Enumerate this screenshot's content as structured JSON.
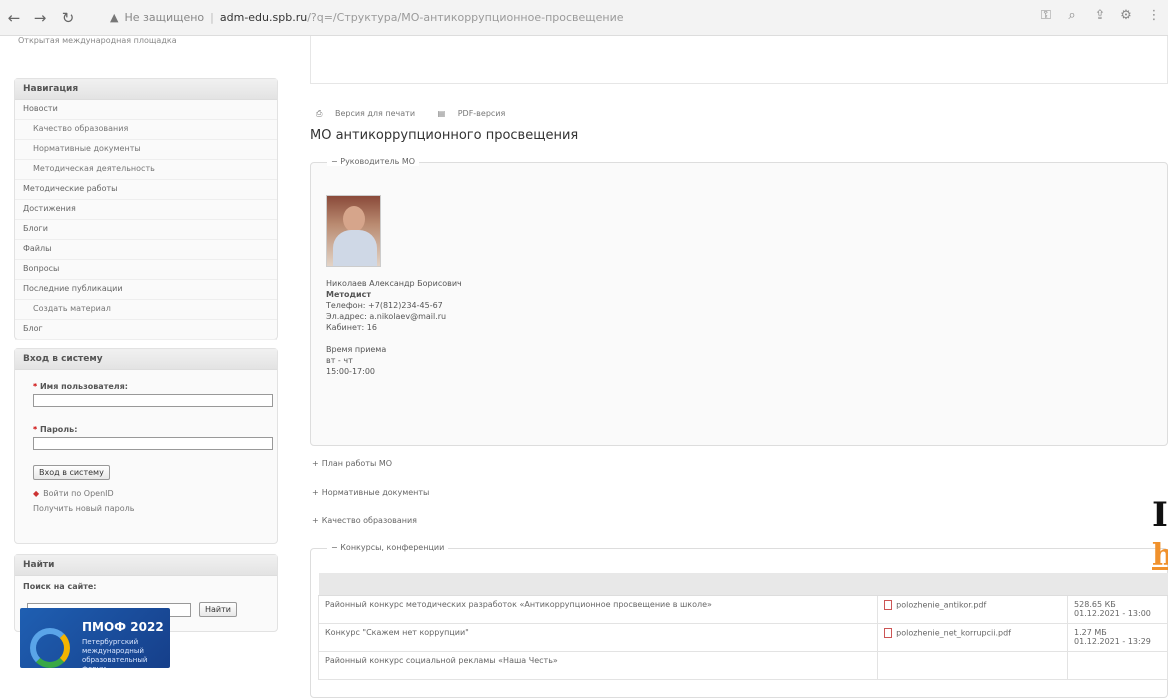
{
  "browser": {
    "insecure_label": "Не защищено",
    "host": "adm-edu.spb.ru",
    "path": "/?q=/Структура/МО-антикоррупционное-просвещение"
  },
  "sidebar": {
    "top_text": "Открытая международная площадка",
    "nav_title": "Навигация",
    "nav_items": [
      {
        "label": "Новости",
        "sub": false
      },
      {
        "label": "Качество образования",
        "sub": true
      },
      {
        "label": "Нормативные документы",
        "sub": true
      },
      {
        "label": "Методическая деятельность",
        "sub": true
      },
      {
        "label": "Методические работы",
        "sub": false
      },
      {
        "label": "Достижения",
        "sub": false
      },
      {
        "label": "Блоги",
        "sub": false
      },
      {
        "label": "Файлы",
        "sub": false
      },
      {
        "label": "Вопросы",
        "sub": false
      },
      {
        "label": "Последние публикации",
        "sub": false
      },
      {
        "label": "Создать материал",
        "sub": true
      },
      {
        "label": "Блог",
        "sub": false
      }
    ],
    "login": {
      "title": "Вход в систему",
      "username_label": "Имя пользователя:",
      "password_label": "Пароль:",
      "submit": "Вход в систему",
      "register_link": "Войти по OpenID",
      "forgot_link": "Получить новый пароль"
    },
    "search": {
      "title": "Найти",
      "label": "Поиск на сайте:",
      "button": "Найти"
    },
    "logo": {
      "title": "ПМОФ 2022",
      "subtitle": "Петербургский международный образовательный форум"
    }
  },
  "main": {
    "print_link": "Версия для печати",
    "pdf_link": "PDF-версия",
    "title": "МО антикоррупционного просвещения",
    "leader_legend": "Руководитель МО",
    "leader": {
      "name": "Николаев Александр Борисович",
      "role": "Методист",
      "phone": "Телефон: +7(812)234-45-67",
      "email": "Эл.адрес: a.nikolaev@mail.ru",
      "room": "Кабинет: 16",
      "hours_title": "Время приема",
      "days": "вт - чт",
      "hours": "15:00-17:00"
    },
    "sections": [
      "План работы МО",
      "Нормативные документы",
      "Качество образования"
    ],
    "contests_legend": "Конкурсы, конференции",
    "table": {
      "rows": [
        {
          "title": "Районный конкурс методических разработок «Антикоррупционное просвещение в школе»",
          "file": "polozhenie_antikor.pdf",
          "size": "528.65 КБ",
          "date": "01.12.2021 - 13:00"
        },
        {
          "title": "Конкурс \"Скажем нет коррупции\"",
          "file": "polozhenie_net_korrupcii.pdf",
          "size": "1.27 МБ",
          "date": "01.12.2021 - 13:29"
        },
        {
          "title": "Районный конкурс социальной рекламы «Наша Честь»",
          "file": "",
          "size": "",
          "date": ""
        }
      ]
    }
  },
  "overlay": {
    "line1": "I",
    "line2": "h"
  }
}
